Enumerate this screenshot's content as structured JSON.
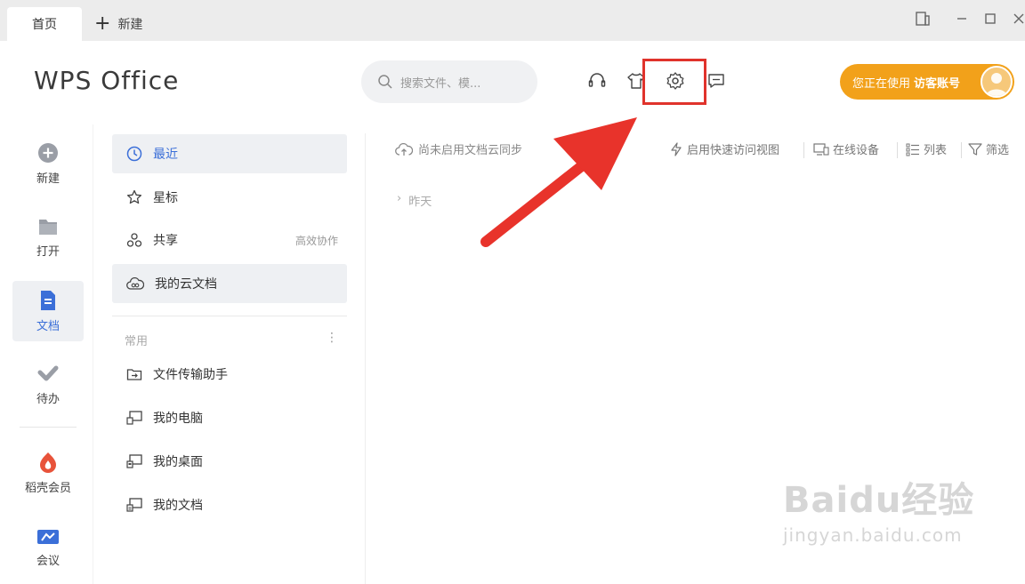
{
  "titlebar": {
    "tab_home": "首页",
    "tab_new": "新建"
  },
  "header": {
    "logo": "WPS Office",
    "search_placeholder": "搜索文件、模...",
    "user_prefix": "您正在使用",
    "user_account": "访客账号"
  },
  "rail": {
    "items": [
      {
        "label": "新建",
        "icon": "plus-circle-icon"
      },
      {
        "label": "打开",
        "icon": "folder-icon"
      },
      {
        "label": "文档",
        "icon": "document-icon"
      },
      {
        "label": "待办",
        "icon": "check-icon"
      },
      {
        "label": "稻壳会员",
        "icon": "flame-icon"
      },
      {
        "label": "会议",
        "icon": "video-icon"
      }
    ]
  },
  "nav": {
    "recent": "最近",
    "starred": "星标",
    "shared": "共享",
    "shared_hint": "高效协作",
    "cloud_docs": "我的云文档",
    "section_common": "常用",
    "transfer": "文件传输助手",
    "my_computer": "我的电脑",
    "my_desktop": "我的桌面",
    "my_documents": "我的文档"
  },
  "main": {
    "cloud_sync": "尚未启用文档云同步",
    "quick_view": "启用快速访问视图",
    "online_devices": "在线设备",
    "list": "列表",
    "filter": "筛选",
    "group_yesterday": "昨天"
  },
  "watermark": {
    "main": "Baidu经验",
    "sub": "jingyan.baidu.com"
  },
  "colors": {
    "accent_blue": "#3b6fd8",
    "user_orange": "#f2a11a",
    "highlight_red": "#e0332c"
  }
}
